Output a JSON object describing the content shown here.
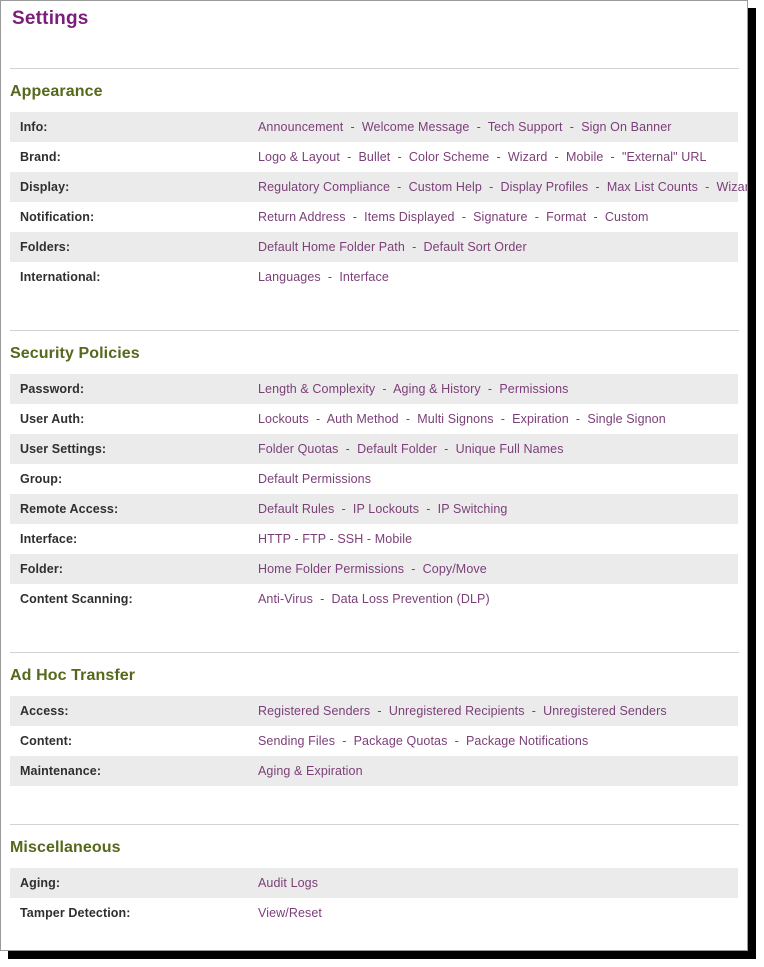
{
  "page": {
    "title": "Settings"
  },
  "colors": {
    "title": "#7B1E7A",
    "section_heading": "#55681C",
    "link": "#7B3F78",
    "label": "#2f2f2f",
    "row_stripe": "#ebebeb",
    "divider": "#d2d2d2"
  },
  "separator": "  -  ",
  "separator_tight": " - ",
  "sections": [
    {
      "heading": "Appearance",
      "rows": [
        {
          "label": "Info:",
          "links": [
            "Announcement",
            "Welcome Message",
            "Tech Support",
            "Sign On Banner"
          ]
        },
        {
          "label": "Brand:",
          "links": [
            "Logo & Layout",
            "Bullet",
            "Color Scheme",
            "Wizard",
            "Mobile",
            "\"External\" URL"
          ]
        },
        {
          "label": "Display:",
          "links": [
            "Regulatory Compliance",
            "Custom Help",
            "Display Profiles",
            "Max List Counts",
            "Wizard"
          ]
        },
        {
          "label": "Notification:",
          "links": [
            "Return Address",
            "Items Displayed",
            "Signature",
            "Format",
            "Custom"
          ]
        },
        {
          "label": "Folders:",
          "links": [
            "Default Home Folder Path",
            "Default Sort Order"
          ]
        },
        {
          "label": "International:",
          "links": [
            "Languages",
            "Interface"
          ]
        }
      ]
    },
    {
      "heading": "Security Policies",
      "rows": [
        {
          "label": "Password:",
          "links": [
            "Length & Complexity",
            "Aging & History",
            "Permissions"
          ]
        },
        {
          "label": "User Auth:",
          "links": [
            "Lockouts",
            "Auth Method",
            "Multi Signons",
            "Expiration",
            "Single Signon"
          ]
        },
        {
          "label": "User Settings:",
          "links": [
            "Folder Quotas",
            "Default Folder",
            "Unique Full Names"
          ]
        },
        {
          "label": "Group:",
          "links": [
            "Default Permissions"
          ]
        },
        {
          "label": "Remote Access:",
          "links": [
            "Default Rules",
            "IP Lockouts",
            "IP Switching"
          ]
        },
        {
          "label": "Interface:",
          "tight": true,
          "links": [
            "HTTP",
            "FTP",
            "SSH",
            "Mobile"
          ]
        },
        {
          "label": "Folder:",
          "links": [
            "Home Folder Permissions",
            "Copy/Move"
          ]
        },
        {
          "label": "Content Scanning:",
          "links": [
            "Anti-Virus",
            "Data Loss Prevention (DLP)"
          ]
        }
      ]
    },
    {
      "heading": "Ad Hoc Transfer",
      "rows": [
        {
          "label": "Access:",
          "links": [
            "Registered Senders",
            "Unregistered Recipients",
            "Unregistered Senders"
          ]
        },
        {
          "label": "Content:",
          "links": [
            "Sending Files",
            "Package Quotas",
            "Package Notifications"
          ]
        },
        {
          "label": "Maintenance:",
          "links": [
            "Aging & Expiration"
          ]
        }
      ]
    },
    {
      "heading": "Miscellaneous",
      "rows": [
        {
          "label": "Aging:",
          "links": [
            "Audit Logs"
          ]
        },
        {
          "label": "Tamper Detection:",
          "links": [
            "View/Reset"
          ]
        }
      ]
    }
  ]
}
